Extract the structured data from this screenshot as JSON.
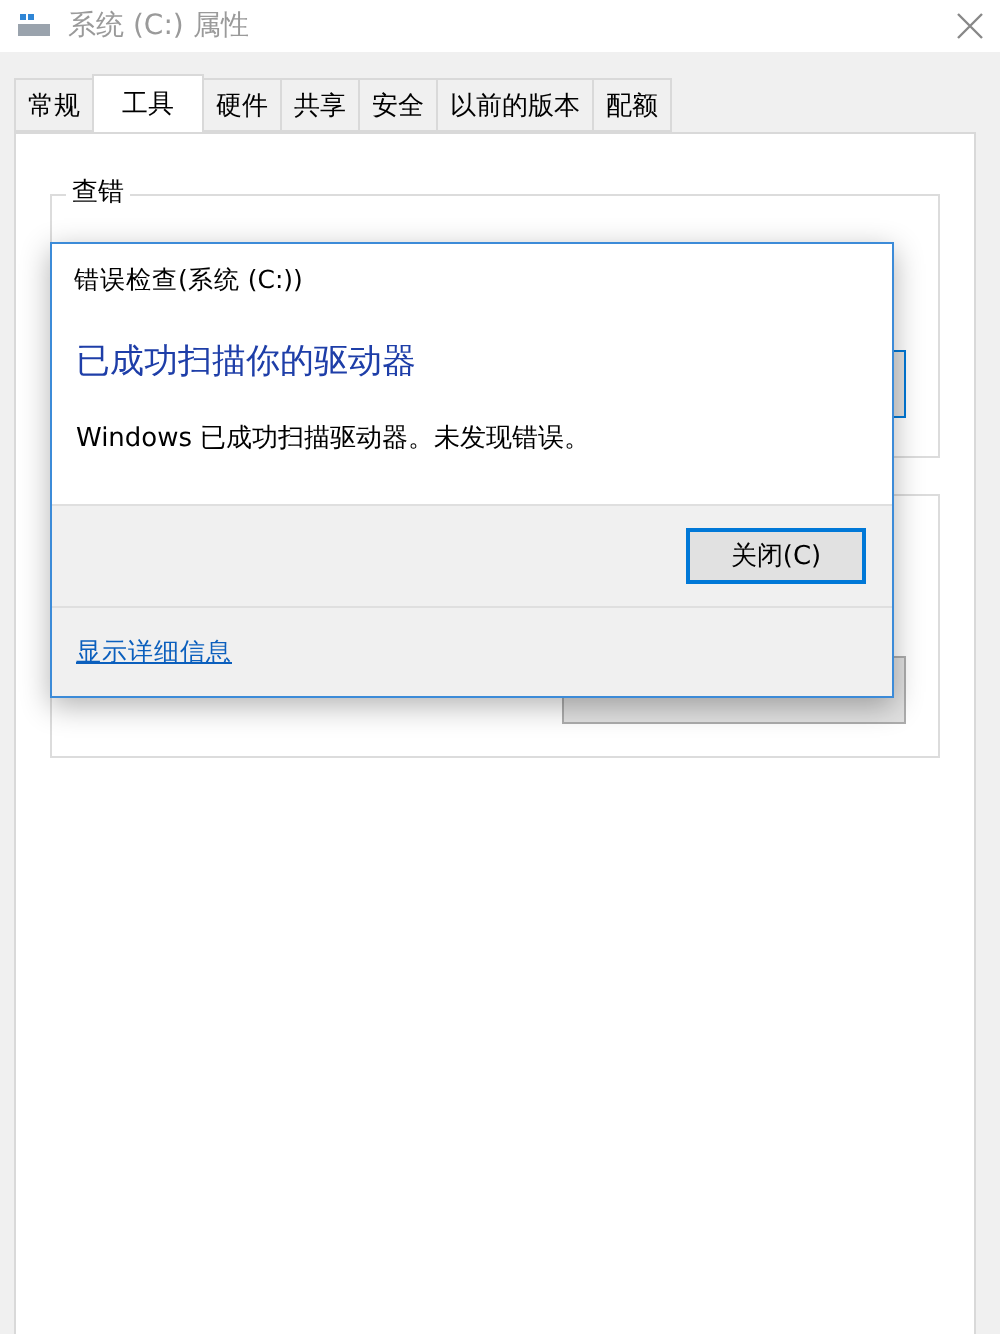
{
  "window": {
    "title": "系统 (C:) 属性"
  },
  "tabs": [
    {
      "label": "常规",
      "selected": false
    },
    {
      "label": "工具",
      "selected": true
    },
    {
      "label": "硬件",
      "selected": false
    },
    {
      "label": "共享",
      "selected": false
    },
    {
      "label": "安全",
      "selected": false
    },
    {
      "label": "以前的版本",
      "selected": false
    },
    {
      "label": "配额",
      "selected": false
    }
  ],
  "groups": [
    {
      "title": "查错",
      "button_focused": true
    },
    {
      "button_focused": false
    }
  ],
  "dialog": {
    "title": "错误检查(系统 (C:))",
    "heading": "已成功扫描你的驱动器",
    "message": "Windows 已成功扫描驱动器。未发现错误。",
    "button": "关闭(C)",
    "link": "显示详细信息"
  }
}
